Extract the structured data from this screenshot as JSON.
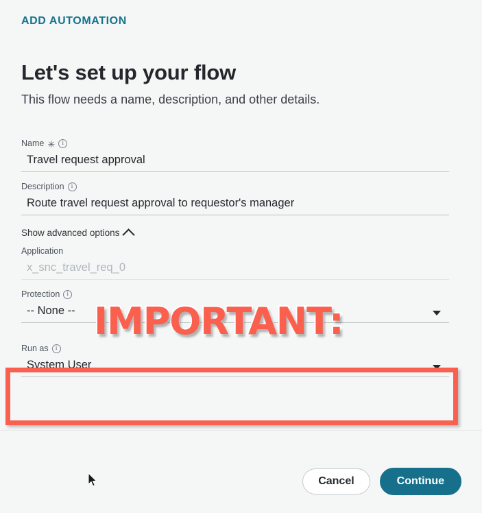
{
  "header": {
    "eyebrow": "ADD AUTOMATION",
    "title": "Let's set up your flow",
    "subtitle": "This flow needs a name, description, and other details."
  },
  "form": {
    "name_field": {
      "label": "Name",
      "required_marker": "✳",
      "info_icon": "info-circle-icon",
      "value": "Travel request approval",
      "placeholder": ""
    },
    "description_field": {
      "label": "Description",
      "info_icon": "info-circle-icon",
      "value": "Route travel request approval to requestor's manager",
      "placeholder": ""
    },
    "advanced_toggle": {
      "label": "Show advanced options",
      "icon": "chevron-up-icon",
      "expanded": true
    },
    "application_field": {
      "label": "Application",
      "value": "x_snc_travel_req_0",
      "disabled": true
    },
    "protection_field": {
      "label": "Protection",
      "info_icon": "info-circle-icon",
      "value": "-- None --",
      "caret": "caret-down-icon"
    },
    "run_as_field": {
      "label": "Run as",
      "info_icon": "info-circle-icon",
      "value": "System User",
      "caret": "caret-down-icon",
      "highlighted": true
    }
  },
  "annotation": {
    "important_text": "IMPORTANT:",
    "highlight_color": "#f9604f",
    "text_color": "#fb5f4e"
  },
  "footer": {
    "cancel_label": "Cancel",
    "continue_label": "Continue"
  },
  "colors": {
    "accent_teal": "#16708b",
    "eyebrow_teal": "#15738e",
    "page_background": "#f5f6f6",
    "annotation_red": "#f9604f"
  }
}
